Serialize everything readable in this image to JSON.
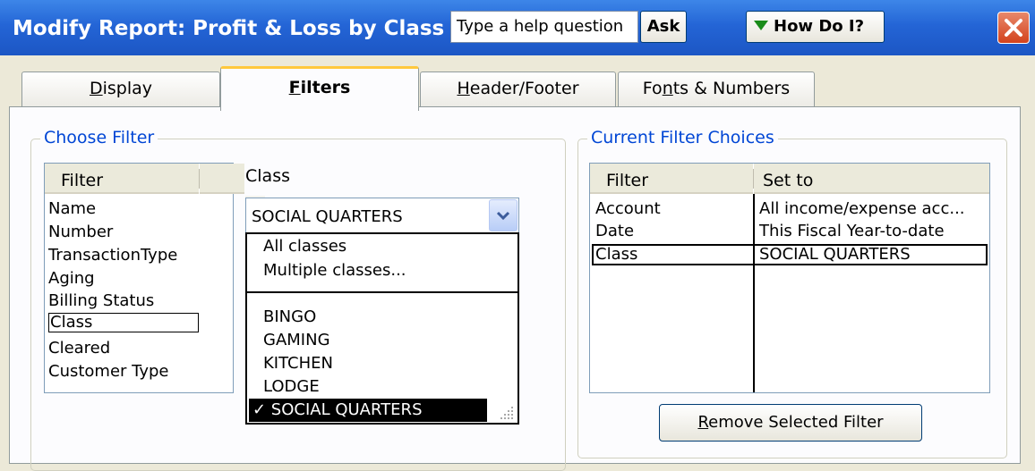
{
  "window": {
    "title": "Modify Report: Profit & Loss by Class",
    "help_placeholder": "Type a help question",
    "ask_label": "Ask",
    "howdoi_label": "How Do I?"
  },
  "tabs": [
    {
      "mn": "D",
      "rest": "isplay",
      "active": false
    },
    {
      "mn": "F",
      "rest": "ilters",
      "active": true
    },
    {
      "mn": "H",
      "rest": "eader/Footer",
      "active": false
    },
    {
      "pre": "Fo",
      "mn": "n",
      "rest": "ts & Numbers",
      "active": false
    }
  ],
  "choose_filter": {
    "legend": "Choose Filter",
    "list_header": "Filter",
    "items": [
      "Name",
      "Number",
      "TransactionType",
      "Aging",
      "Billing Status",
      "Class",
      "Cleared",
      "Customer Type"
    ],
    "selected": "Class"
  },
  "class_filter": {
    "label": "Class",
    "value": "SOCIAL QUARTERS",
    "special_options": [
      "All classes",
      "Multiple classes..."
    ],
    "options": [
      "BINGO",
      "GAMING",
      "KITCHEN",
      "LODGE"
    ],
    "checked_option": "✓ SOCIAL QUARTERS"
  },
  "current_filters": {
    "legend": "Current Filter Choices",
    "headers": [
      "Filter",
      "Set to"
    ],
    "rows": [
      {
        "filter": "Account",
        "set_to": "All income/expense acc..."
      },
      {
        "filter": "Date",
        "set_to": "This Fiscal Year-to-date"
      },
      {
        "filter": "Class",
        "set_to": "SOCIAL QUARTERS"
      }
    ],
    "selected_row": "Class",
    "remove_button": {
      "mn": "R",
      "rest": "emove Selected Filter"
    }
  }
}
